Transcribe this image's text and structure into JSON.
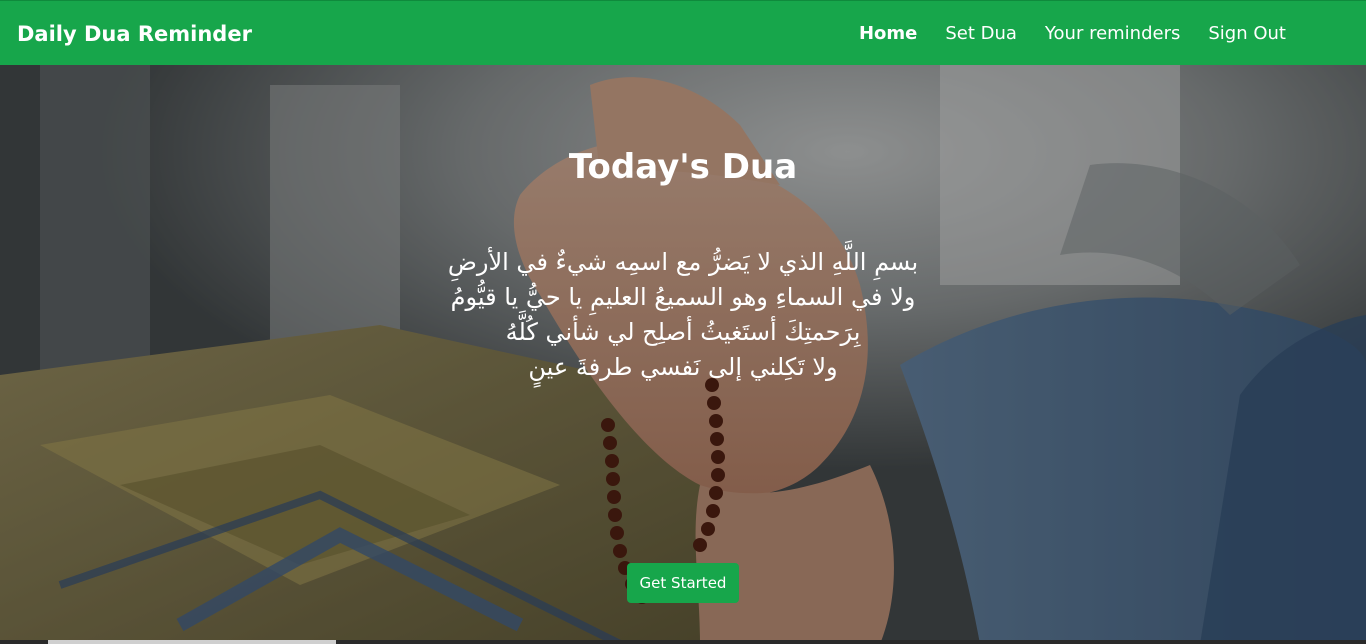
{
  "navbar": {
    "brand": "Daily Dua Reminder",
    "links": [
      {
        "label": "Home",
        "active": true
      },
      {
        "label": "Set Dua",
        "active": false
      },
      {
        "label": "Your reminders",
        "active": false
      },
      {
        "label": "Sign Out",
        "active": false
      }
    ],
    "background_color": "#17a64b"
  },
  "hero": {
    "title": "Today's Dua",
    "dua_lines": [
      "بسمِ اللَّهِ الذي لا يَضرُّ مع اسمِه شيءٌ في الأرضِ",
      "ولا في السماءِ وهو السميعُ العليمِ يا حيُّ يا قيُّومُ",
      "بِرَحمتِكَ أستَغيثُ أصلِح لي شأني كُلَّهُ",
      "ولا تَكِلني إلى نَفسي طرفةَ عينٍ"
    ],
    "cta_label": "Get Started",
    "background_description_icon": "praying-hands-with-prayer-beads-image"
  }
}
